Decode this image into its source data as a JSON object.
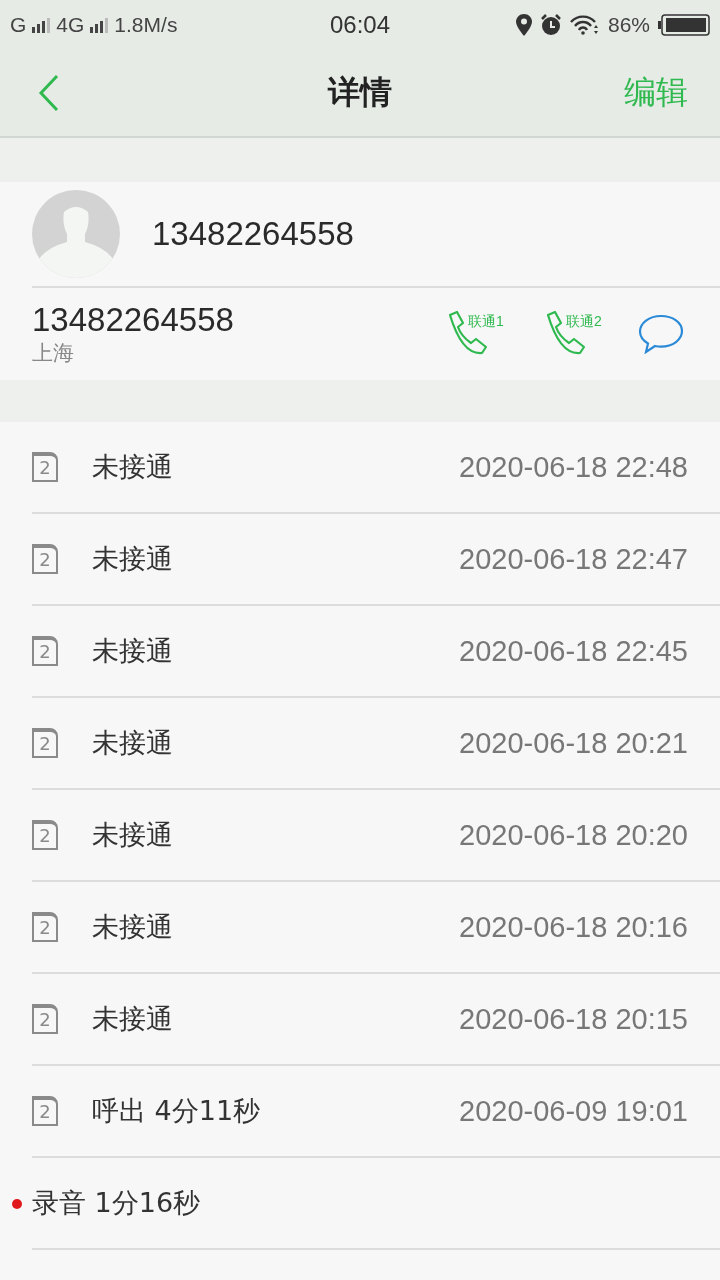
{
  "status_bar": {
    "network_1": "G",
    "network_2": "4G",
    "speed": "1.8M/s",
    "time": "06:04",
    "battery": "86%"
  },
  "header": {
    "title": "详情",
    "action": "编辑"
  },
  "contact": {
    "name": "13482264558",
    "number": "13482264558",
    "location": "上海",
    "actions": [
      {
        "kind": "call",
        "label": "联通1"
      },
      {
        "kind": "call",
        "label": "联通2"
      },
      {
        "kind": "message"
      }
    ]
  },
  "records": [
    {
      "kind": "call",
      "sim": "2",
      "label": "未接通",
      "time": "2020-06-18 22:48"
    },
    {
      "kind": "call",
      "sim": "2",
      "label": "未接通",
      "time": "2020-06-18 22:47"
    },
    {
      "kind": "call",
      "sim": "2",
      "label": "未接通",
      "time": "2020-06-18 22:45"
    },
    {
      "kind": "call",
      "sim": "2",
      "label": "未接通",
      "time": "2020-06-18 20:21"
    },
    {
      "kind": "call",
      "sim": "2",
      "label": "未接通",
      "time": "2020-06-18 20:20"
    },
    {
      "kind": "call",
      "sim": "2",
      "label": "未接通",
      "time": "2020-06-18 20:16"
    },
    {
      "kind": "call",
      "sim": "2",
      "label": "未接通",
      "time": "2020-06-18 20:15"
    },
    {
      "kind": "call",
      "sim": "2",
      "label": "呼出 4分11秒",
      "time": "2020-06-09 19:01"
    },
    {
      "kind": "recording",
      "label": "录音 1分16秒"
    }
  ]
}
